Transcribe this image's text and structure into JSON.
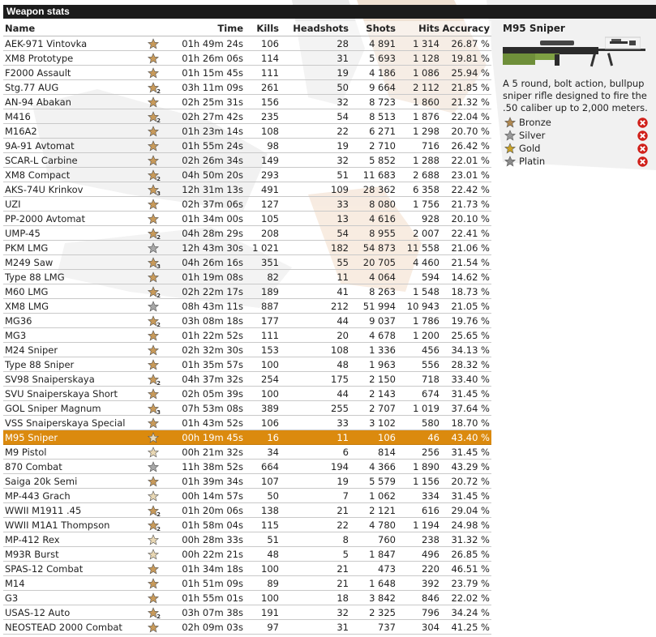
{
  "panel": {
    "title": "Weapon stats"
  },
  "table": {
    "headers": {
      "name": "Name",
      "time": "Time",
      "kills": "Kills",
      "headshots": "Headshots",
      "shots": "Shots",
      "hits": "Hits",
      "accuracy": "Accuracy"
    },
    "rows": [
      {
        "name": "AEK-971 Vintovka",
        "rank": "bronze",
        "time": "01h 49m 24s",
        "kills": "106",
        "headshots": "28",
        "shots": "4 891",
        "hits": "1 314",
        "accuracy": "26.87 %"
      },
      {
        "name": "XM8 Prototype",
        "rank": "bronze",
        "time": "01h 26m 06s",
        "kills": "114",
        "headshots": "31",
        "shots": "5 693",
        "hits": "1 128",
        "accuracy": "19.81 %"
      },
      {
        "name": "F2000 Assault",
        "rank": "bronze",
        "time": "01h 15m 45s",
        "kills": "111",
        "headshots": "19",
        "shots": "4 186",
        "hits": "1 086",
        "accuracy": "25.94 %"
      },
      {
        "name": "Stg.77 AUG",
        "rank": "bronze2",
        "time": "03h 11m 09s",
        "kills": "261",
        "headshots": "50",
        "shots": "9 664",
        "hits": "2 112",
        "accuracy": "21.85 %"
      },
      {
        "name": "AN-94 Abakan",
        "rank": "bronze",
        "time": "02h 25m 31s",
        "kills": "156",
        "headshots": "32",
        "shots": "8 723",
        "hits": "1 860",
        "accuracy": "21.32 %"
      },
      {
        "name": "M416",
        "rank": "bronze2",
        "time": "02h 27m 42s",
        "kills": "235",
        "headshots": "54",
        "shots": "8 513",
        "hits": "1 876",
        "accuracy": "22.04 %"
      },
      {
        "name": "M16A2",
        "rank": "bronze",
        "time": "01h 23m 14s",
        "kills": "108",
        "headshots": "22",
        "shots": "6 271",
        "hits": "1 298",
        "accuracy": "20.70 %"
      },
      {
        "name": "9A-91 Avtomat",
        "rank": "bronze",
        "time": "01h 55m 24s",
        "kills": "98",
        "headshots": "19",
        "shots": "2 710",
        "hits": "716",
        "accuracy": "26.42 %"
      },
      {
        "name": "SCAR-L Carbine",
        "rank": "bronze",
        "time": "02h 26m 34s",
        "kills": "149",
        "headshots": "32",
        "shots": "5 852",
        "hits": "1 288",
        "accuracy": "22.01 %"
      },
      {
        "name": "XM8 Compact",
        "rank": "bronze2",
        "time": "04h 50m 20s",
        "kills": "293",
        "headshots": "51",
        "shots": "11 683",
        "hits": "2 688",
        "accuracy": "23.01 %"
      },
      {
        "name": "AKS-74U Krinkov",
        "rank": "bronze3",
        "time": "12h 31m 13s",
        "kills": "491",
        "headshots": "109",
        "shots": "28 362",
        "hits": "6 358",
        "accuracy": "22.42 %"
      },
      {
        "name": "UZI",
        "rank": "bronze",
        "time": "02h 37m 06s",
        "kills": "127",
        "headshots": "33",
        "shots": "8 080",
        "hits": "1 756",
        "accuracy": "21.73 %"
      },
      {
        "name": "PP-2000 Avtomat",
        "rank": "bronze",
        "time": "01h 34m 00s",
        "kills": "105",
        "headshots": "13",
        "shots": "4 616",
        "hits": "928",
        "accuracy": "20.10 %"
      },
      {
        "name": "UMP-45",
        "rank": "bronze2",
        "time": "04h 28m 29s",
        "kills": "208",
        "headshots": "54",
        "shots": "8 955",
        "hits": "2 007",
        "accuracy": "22.41 %"
      },
      {
        "name": "PKM LMG",
        "rank": "silver",
        "time": "12h 43m 30s",
        "kills": "1 021",
        "headshots": "182",
        "shots": "54 873",
        "hits": "11 558",
        "accuracy": "21.06 %"
      },
      {
        "name": "M249 Saw",
        "rank": "bronze3",
        "time": "04h 26m 16s",
        "kills": "351",
        "headshots": "55",
        "shots": "20 705",
        "hits": "4 460",
        "accuracy": "21.54 %"
      },
      {
        "name": "Type 88 LMG",
        "rank": "bronze",
        "time": "01h 19m 08s",
        "kills": "82",
        "headshots": "11",
        "shots": "4 064",
        "hits": "594",
        "accuracy": "14.62 %"
      },
      {
        "name": "M60 LMG",
        "rank": "bronze2",
        "time": "02h 22m 17s",
        "kills": "189",
        "headshots": "41",
        "shots": "8 263",
        "hits": "1 548",
        "accuracy": "18.73 %"
      },
      {
        "name": "XM8 LMG",
        "rank": "silver",
        "time": "08h 43m 11s",
        "kills": "887",
        "headshots": "212",
        "shots": "51 994",
        "hits": "10 943",
        "accuracy": "21.05 %"
      },
      {
        "name": "MG36",
        "rank": "bronze2",
        "time": "03h 08m 18s",
        "kills": "177",
        "headshots": "44",
        "shots": "9 037",
        "hits": "1 786",
        "accuracy": "19.76 %"
      },
      {
        "name": "MG3",
        "rank": "bronze",
        "time": "01h 22m 52s",
        "kills": "111",
        "headshots": "20",
        "shots": "4 678",
        "hits": "1 200",
        "accuracy": "25.65 %"
      },
      {
        "name": "M24 Sniper",
        "rank": "bronze",
        "time": "02h 32m 30s",
        "kills": "153",
        "headshots": "108",
        "shots": "1 336",
        "hits": "456",
        "accuracy": "34.13 %"
      },
      {
        "name": "Type 88 Sniper",
        "rank": "bronze",
        "time": "01h 35m 57s",
        "kills": "100",
        "headshots": "48",
        "shots": "1 963",
        "hits": "556",
        "accuracy": "28.32 %"
      },
      {
        "name": "SV98 Snaiperskaya",
        "rank": "bronze2",
        "time": "04h 37m 32s",
        "kills": "254",
        "headshots": "175",
        "shots": "2 150",
        "hits": "718",
        "accuracy": "33.40 %"
      },
      {
        "name": "SVU Snaiperskaya Short",
        "rank": "bronze",
        "time": "02h 05m 39s",
        "kills": "100",
        "headshots": "44",
        "shots": "2 143",
        "hits": "674",
        "accuracy": "31.45 %"
      },
      {
        "name": "GOL Sniper Magnum",
        "rank": "bronze3",
        "time": "07h 53m 08s",
        "kills": "389",
        "headshots": "255",
        "shots": "2 707",
        "hits": "1 019",
        "accuracy": "37.64 %"
      },
      {
        "name": "VSS Snaiperskaya Special",
        "rank": "bronze",
        "time": "01h 43m 52s",
        "kills": "106",
        "headshots": "33",
        "shots": "3 102",
        "hits": "580",
        "accuracy": "18.70 %"
      },
      {
        "name": "M95 Sniper",
        "rank": "none",
        "time": "00h 19m 45s",
        "kills": "16",
        "headshots": "11",
        "shots": "106",
        "hits": "46",
        "accuracy": "43.40 %",
        "selected": true
      },
      {
        "name": "M9 Pistol",
        "rank": "none",
        "time": "00h 21m 32s",
        "kills": "34",
        "headshots": "6",
        "shots": "814",
        "hits": "256",
        "accuracy": "31.45 %"
      },
      {
        "name": "870 Combat",
        "rank": "silver",
        "time": "11h 38m 52s",
        "kills": "664",
        "headshots": "194",
        "shots": "4 366",
        "hits": "1 890",
        "accuracy": "43.29 %"
      },
      {
        "name": "Saiga 20k Semi",
        "rank": "bronze",
        "time": "01h 39m 34s",
        "kills": "107",
        "headshots": "19",
        "shots": "5 579",
        "hits": "1 156",
        "accuracy": "20.72 %"
      },
      {
        "name": "MP-443 Grach",
        "rank": "none",
        "time": "00h 14m 57s",
        "kills": "50",
        "headshots": "7",
        "shots": "1 062",
        "hits": "334",
        "accuracy": "31.45 %"
      },
      {
        "name": "WWII M1911 .45",
        "rank": "bronze2",
        "time": "01h 20m 06s",
        "kills": "138",
        "headshots": "21",
        "shots": "2 121",
        "hits": "616",
        "accuracy": "29.04 %"
      },
      {
        "name": "WWII M1A1 Thompson",
        "rank": "bronze2",
        "time": "01h 58m 04s",
        "kills": "115",
        "headshots": "22",
        "shots": "4 780",
        "hits": "1 194",
        "accuracy": "24.98 %"
      },
      {
        "name": "MP-412 Rex",
        "rank": "none",
        "time": "00h 28m 33s",
        "kills": "51",
        "headshots": "8",
        "shots": "760",
        "hits": "238",
        "accuracy": "31.32 %"
      },
      {
        "name": "M93R Burst",
        "rank": "none",
        "time": "00h 22m 21s",
        "kills": "48",
        "headshots": "5",
        "shots": "1 847",
        "hits": "496",
        "accuracy": "26.85 %"
      },
      {
        "name": "SPAS-12 Combat",
        "rank": "bronze",
        "time": "01h 34m 18s",
        "kills": "100",
        "headshots": "21",
        "shots": "473",
        "hits": "220",
        "accuracy": "46.51 %"
      },
      {
        "name": "M14",
        "rank": "bronze",
        "time": "01h 51m 09s",
        "kills": "89",
        "headshots": "21",
        "shots": "1 648",
        "hits": "392",
        "accuracy": "23.79 %"
      },
      {
        "name": "G3",
        "rank": "bronze",
        "time": "01h 55m 01s",
        "kills": "100",
        "headshots": "18",
        "shots": "3 842",
        "hits": "846",
        "accuracy": "22.02 %"
      },
      {
        "name": "USAS-12 Auto",
        "rank": "bronze2",
        "time": "03h 07m 38s",
        "kills": "191",
        "headshots": "32",
        "shots": "2 325",
        "hits": "796",
        "accuracy": "34.24 %"
      },
      {
        "name": "NEOSTEAD 2000 Combat",
        "rank": "bronze",
        "time": "02h 09m 03s",
        "kills": "97",
        "headshots": "31",
        "shots": "737",
        "hits": "304",
        "accuracy": "41.25 %"
      }
    ]
  },
  "detail": {
    "title": "M95 Sniper",
    "description": "A 5 round, bolt action, bullpup sniper rifle designed to fire the .50 caliber up to 2,000 meters.",
    "awards": [
      {
        "label": "Bronze",
        "icon": "bronze-star-icon",
        "color": "#b08850"
      },
      {
        "label": "Silver",
        "icon": "silver-star-icon",
        "color": "#9a9a9a"
      },
      {
        "label": "Gold",
        "icon": "gold-star-icon",
        "color": "#c9a227"
      },
      {
        "label": "Platin",
        "icon": "platinum-star-icon",
        "color": "#8c8c8c"
      }
    ]
  },
  "colors": {
    "title_bar": "#1c1c1c",
    "selected_row": "#db8a0e",
    "remove": "#d0201a"
  }
}
